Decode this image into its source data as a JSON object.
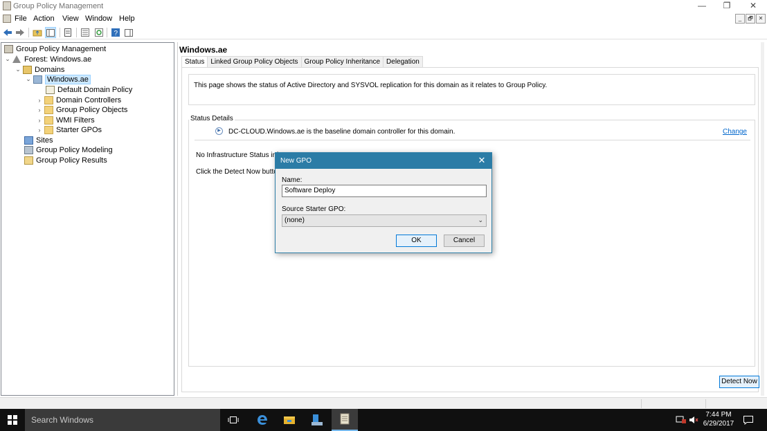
{
  "window": {
    "title": "Group Policy Management",
    "controls": {
      "minimize": "—",
      "restore": "❐",
      "close": "✕"
    }
  },
  "menu": [
    "File",
    "Action",
    "View",
    "Window",
    "Help"
  ],
  "mdi_controls": [
    "_",
    "🗗",
    "✕"
  ],
  "tree": {
    "root": "Group Policy Management",
    "forest": "Forest: Windows.ae",
    "domains": "Domains",
    "domain": "Windows.ae",
    "children": [
      "Default Domain Policy",
      "Domain Controllers",
      "Group Policy Objects",
      "WMI Filters",
      "Starter GPOs"
    ],
    "sites": "Sites",
    "modeling": "Group Policy Modeling",
    "results": "Group Policy Results"
  },
  "right": {
    "title": "Windows.ae",
    "tabs": [
      "Status",
      "Linked Group Policy Objects",
      "Group Policy Inheritance",
      "Delegation"
    ],
    "info": "This page shows the status of Active Directory and SYSVOL replication for this domain as it relates to Group Policy.",
    "status_details_label": "Status Details",
    "baseline_dc": "DC-CLOUD.Windows.ae is the baseline domain controller for this domain.",
    "change_link": "Change",
    "no_infra": "No Infrastructure Status informa",
    "click_detect": "Click the Detect Now button be",
    "detect_now": "Detect Now"
  },
  "dialog": {
    "title": "New GPO",
    "name_label": "Name:",
    "name_value": "Software Deploy",
    "starter_label": "Source Starter GPO:",
    "starter_value": "(none)",
    "ok": "OK",
    "cancel": "Cancel"
  },
  "taskbar": {
    "search_placeholder": "Search Windows",
    "time": "7:44 PM",
    "date": "6/29/2017"
  },
  "colors": {
    "dialog_titlebar": "#2b7ca6",
    "selection": "#cce8ff",
    "link": "#0066cc",
    "taskbar": "#101010"
  }
}
